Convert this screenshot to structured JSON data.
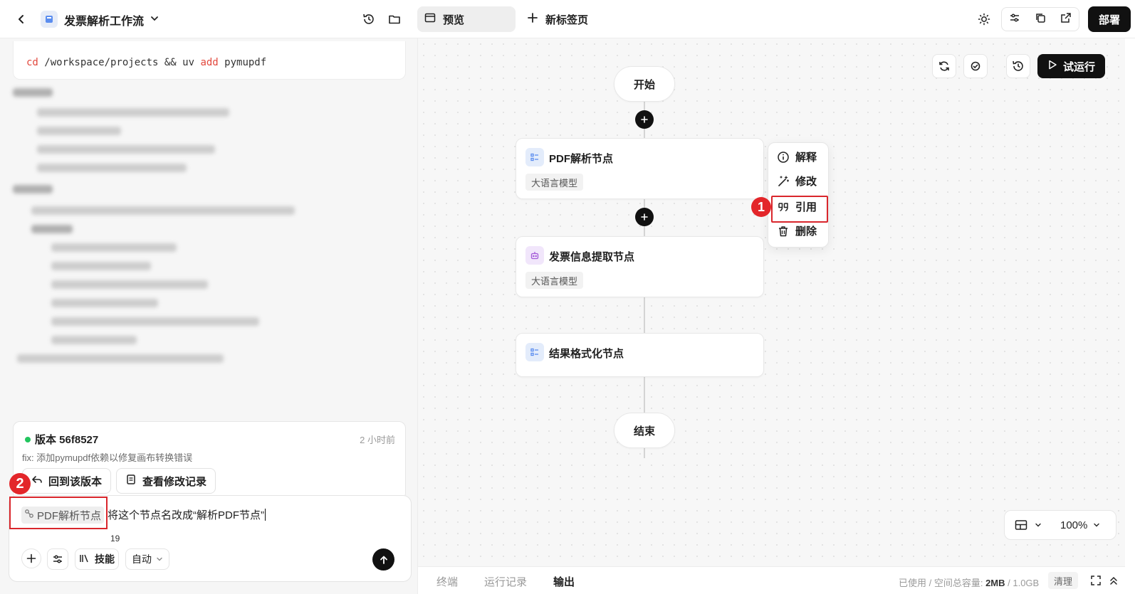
{
  "header": {
    "app_title": "发票解析工作流",
    "tab_preview": "预览",
    "tab_new": "新标签页",
    "deploy_label": "部署"
  },
  "code": {
    "part1": "cd",
    "part2": " /workspace/projects && uv ",
    "part3": "add",
    "part4": " pymupdf"
  },
  "version": {
    "title": "版本 56f8527",
    "time": "2 小时前",
    "description": "fix: 添加pymupdf依赖以修复画布转换错误",
    "revert_label": "回到该版本",
    "history_label": "查看修改记录"
  },
  "badges": {
    "one": "1",
    "two": "2"
  },
  "chat": {
    "chip_label": "PDF解析节点",
    "input_text": "将这个节点名改成“解析PDF节点”",
    "skills_label": "技能",
    "skills_count": "19",
    "mode_label": "自动"
  },
  "canvas": {
    "run_label": "试运行",
    "start_label": "开始",
    "end_label": "结束",
    "nodes": [
      {
        "title": "PDF解析节点",
        "tag": "大语言模型"
      },
      {
        "title": "发票信息提取节点",
        "tag": "大语言模型"
      },
      {
        "title": "结果格式化节点"
      }
    ],
    "context_menu": [
      "解释",
      "修改",
      "引用",
      "删除"
    ],
    "zoom_label": "100%"
  },
  "bottom": {
    "tabs": [
      "终端",
      "运行记录",
      "输出"
    ],
    "active_tab": "输出",
    "storage_prefix": "已使用 / 空间总容量: ",
    "storage_used": "2MB",
    "storage_sep": " / ",
    "storage_total": "1.0GB",
    "clear_label": "清理"
  },
  "colors": {
    "accent_dark": "#111111",
    "highlight_red": "#d9262c",
    "status_green": "#22c55e"
  }
}
